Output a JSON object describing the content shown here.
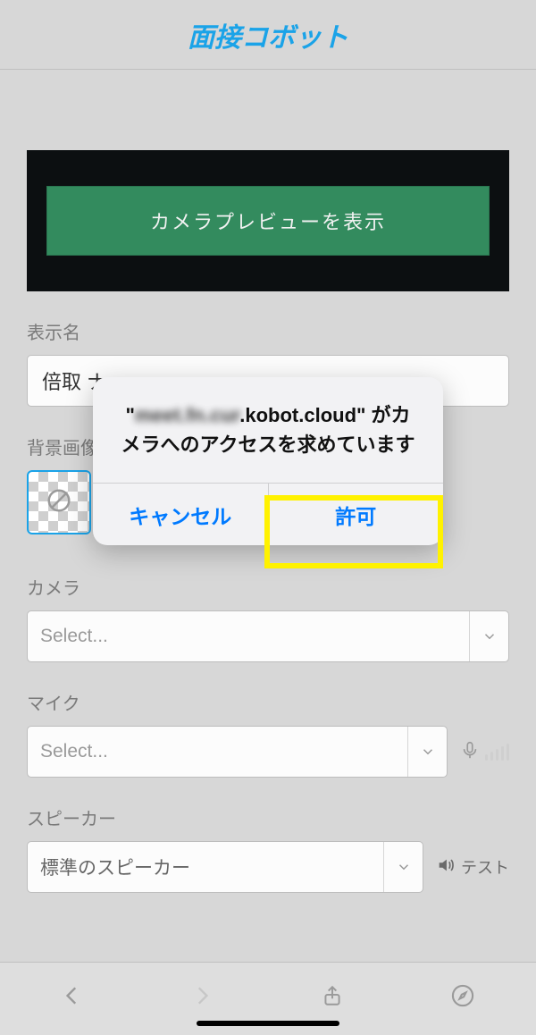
{
  "header": {
    "logo": "面接コボット"
  },
  "preview": {
    "button_label": "カメラプレビューを表示"
  },
  "form": {
    "display_name_label": "表示名",
    "display_name_value": "倍取 ナ",
    "bg_label": "背景画像",
    "camera_label": "カメラ",
    "camera_placeholder": "Select...",
    "mic_label": "マイク",
    "mic_placeholder": "Select...",
    "speaker_label": "スピーカー",
    "speaker_value": "標準のスピーカー",
    "test_label": "テスト"
  },
  "dialog": {
    "host_blurred": "meet.fn.cur",
    "host_clear": ".kobot.cloud",
    "message_suffix": "\" がカメラへのアクセスを求めています",
    "quote_open": "\"",
    "cancel": "キャンセル",
    "allow": "許可"
  }
}
